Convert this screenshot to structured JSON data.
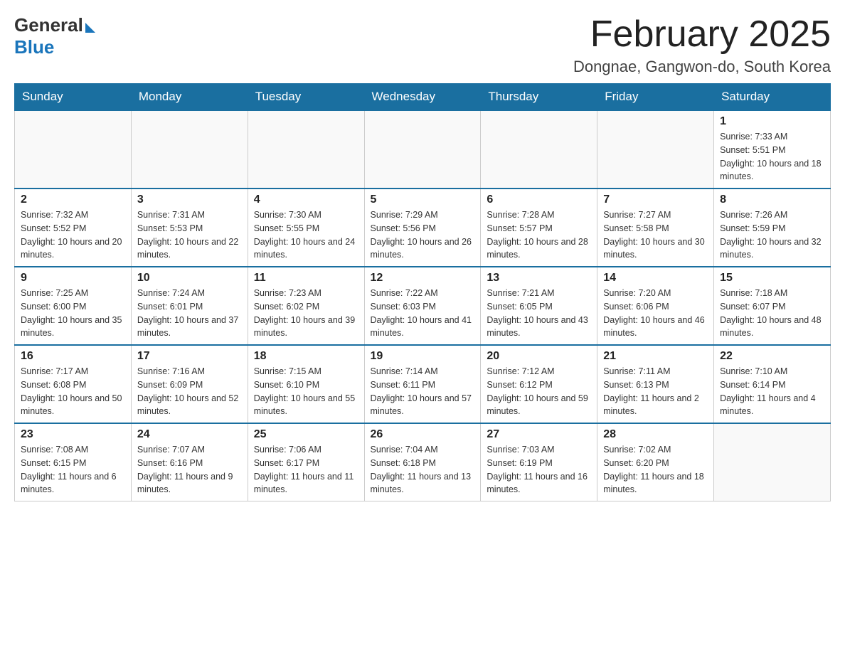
{
  "logo": {
    "general": "General",
    "blue": "Blue"
  },
  "header": {
    "month_title": "February 2025",
    "location": "Dongnae, Gangwon-do, South Korea"
  },
  "days_of_week": [
    "Sunday",
    "Monday",
    "Tuesday",
    "Wednesday",
    "Thursday",
    "Friday",
    "Saturday"
  ],
  "weeks": [
    [
      {
        "day": "",
        "sunrise": "",
        "sunset": "",
        "daylight": ""
      },
      {
        "day": "",
        "sunrise": "",
        "sunset": "",
        "daylight": ""
      },
      {
        "day": "",
        "sunrise": "",
        "sunset": "",
        "daylight": ""
      },
      {
        "day": "",
        "sunrise": "",
        "sunset": "",
        "daylight": ""
      },
      {
        "day": "",
        "sunrise": "",
        "sunset": "",
        "daylight": ""
      },
      {
        "day": "",
        "sunrise": "",
        "sunset": "",
        "daylight": ""
      },
      {
        "day": "1",
        "sunrise": "Sunrise: 7:33 AM",
        "sunset": "Sunset: 5:51 PM",
        "daylight": "Daylight: 10 hours and 18 minutes."
      }
    ],
    [
      {
        "day": "2",
        "sunrise": "Sunrise: 7:32 AM",
        "sunset": "Sunset: 5:52 PM",
        "daylight": "Daylight: 10 hours and 20 minutes."
      },
      {
        "day": "3",
        "sunrise": "Sunrise: 7:31 AM",
        "sunset": "Sunset: 5:53 PM",
        "daylight": "Daylight: 10 hours and 22 minutes."
      },
      {
        "day": "4",
        "sunrise": "Sunrise: 7:30 AM",
        "sunset": "Sunset: 5:55 PM",
        "daylight": "Daylight: 10 hours and 24 minutes."
      },
      {
        "day": "5",
        "sunrise": "Sunrise: 7:29 AM",
        "sunset": "Sunset: 5:56 PM",
        "daylight": "Daylight: 10 hours and 26 minutes."
      },
      {
        "day": "6",
        "sunrise": "Sunrise: 7:28 AM",
        "sunset": "Sunset: 5:57 PM",
        "daylight": "Daylight: 10 hours and 28 minutes."
      },
      {
        "day": "7",
        "sunrise": "Sunrise: 7:27 AM",
        "sunset": "Sunset: 5:58 PM",
        "daylight": "Daylight: 10 hours and 30 minutes."
      },
      {
        "day": "8",
        "sunrise": "Sunrise: 7:26 AM",
        "sunset": "Sunset: 5:59 PM",
        "daylight": "Daylight: 10 hours and 32 minutes."
      }
    ],
    [
      {
        "day": "9",
        "sunrise": "Sunrise: 7:25 AM",
        "sunset": "Sunset: 6:00 PM",
        "daylight": "Daylight: 10 hours and 35 minutes."
      },
      {
        "day": "10",
        "sunrise": "Sunrise: 7:24 AM",
        "sunset": "Sunset: 6:01 PM",
        "daylight": "Daylight: 10 hours and 37 minutes."
      },
      {
        "day": "11",
        "sunrise": "Sunrise: 7:23 AM",
        "sunset": "Sunset: 6:02 PM",
        "daylight": "Daylight: 10 hours and 39 minutes."
      },
      {
        "day": "12",
        "sunrise": "Sunrise: 7:22 AM",
        "sunset": "Sunset: 6:03 PM",
        "daylight": "Daylight: 10 hours and 41 minutes."
      },
      {
        "day": "13",
        "sunrise": "Sunrise: 7:21 AM",
        "sunset": "Sunset: 6:05 PM",
        "daylight": "Daylight: 10 hours and 43 minutes."
      },
      {
        "day": "14",
        "sunrise": "Sunrise: 7:20 AM",
        "sunset": "Sunset: 6:06 PM",
        "daylight": "Daylight: 10 hours and 46 minutes."
      },
      {
        "day": "15",
        "sunrise": "Sunrise: 7:18 AM",
        "sunset": "Sunset: 6:07 PM",
        "daylight": "Daylight: 10 hours and 48 minutes."
      }
    ],
    [
      {
        "day": "16",
        "sunrise": "Sunrise: 7:17 AM",
        "sunset": "Sunset: 6:08 PM",
        "daylight": "Daylight: 10 hours and 50 minutes."
      },
      {
        "day": "17",
        "sunrise": "Sunrise: 7:16 AM",
        "sunset": "Sunset: 6:09 PM",
        "daylight": "Daylight: 10 hours and 52 minutes."
      },
      {
        "day": "18",
        "sunrise": "Sunrise: 7:15 AM",
        "sunset": "Sunset: 6:10 PM",
        "daylight": "Daylight: 10 hours and 55 minutes."
      },
      {
        "day": "19",
        "sunrise": "Sunrise: 7:14 AM",
        "sunset": "Sunset: 6:11 PM",
        "daylight": "Daylight: 10 hours and 57 minutes."
      },
      {
        "day": "20",
        "sunrise": "Sunrise: 7:12 AM",
        "sunset": "Sunset: 6:12 PM",
        "daylight": "Daylight: 10 hours and 59 minutes."
      },
      {
        "day": "21",
        "sunrise": "Sunrise: 7:11 AM",
        "sunset": "Sunset: 6:13 PM",
        "daylight": "Daylight: 11 hours and 2 minutes."
      },
      {
        "day": "22",
        "sunrise": "Sunrise: 7:10 AM",
        "sunset": "Sunset: 6:14 PM",
        "daylight": "Daylight: 11 hours and 4 minutes."
      }
    ],
    [
      {
        "day": "23",
        "sunrise": "Sunrise: 7:08 AM",
        "sunset": "Sunset: 6:15 PM",
        "daylight": "Daylight: 11 hours and 6 minutes."
      },
      {
        "day": "24",
        "sunrise": "Sunrise: 7:07 AM",
        "sunset": "Sunset: 6:16 PM",
        "daylight": "Daylight: 11 hours and 9 minutes."
      },
      {
        "day": "25",
        "sunrise": "Sunrise: 7:06 AM",
        "sunset": "Sunset: 6:17 PM",
        "daylight": "Daylight: 11 hours and 11 minutes."
      },
      {
        "day": "26",
        "sunrise": "Sunrise: 7:04 AM",
        "sunset": "Sunset: 6:18 PM",
        "daylight": "Daylight: 11 hours and 13 minutes."
      },
      {
        "day": "27",
        "sunrise": "Sunrise: 7:03 AM",
        "sunset": "Sunset: 6:19 PM",
        "daylight": "Daylight: 11 hours and 16 minutes."
      },
      {
        "day": "28",
        "sunrise": "Sunrise: 7:02 AM",
        "sunset": "Sunset: 6:20 PM",
        "daylight": "Daylight: 11 hours and 18 minutes."
      },
      {
        "day": "",
        "sunrise": "",
        "sunset": "",
        "daylight": ""
      }
    ]
  ]
}
